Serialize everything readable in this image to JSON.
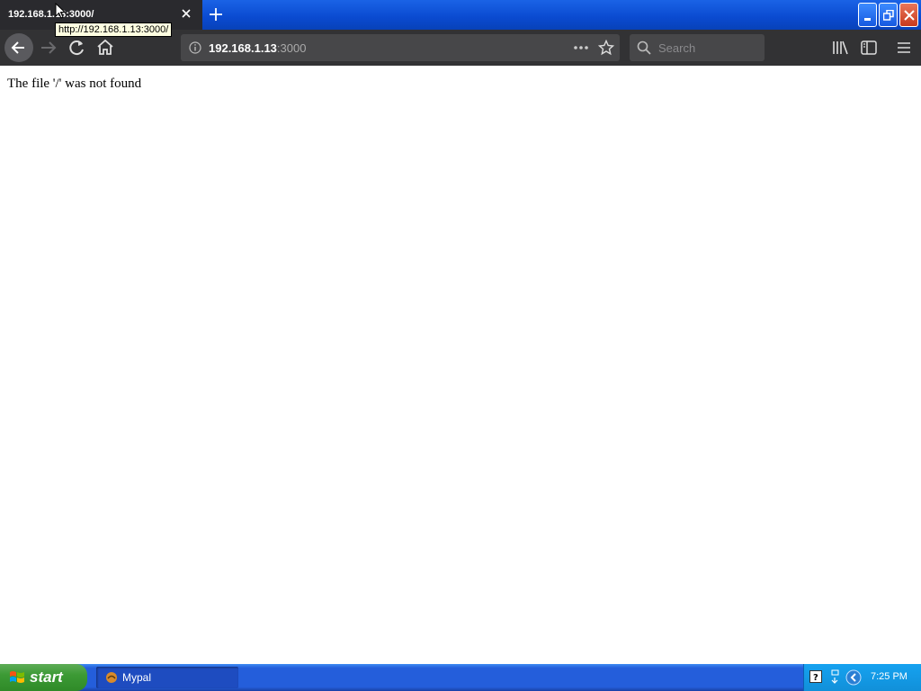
{
  "browser": {
    "tab_title": "192.168.1.13:3000/",
    "tooltip": "http://192.168.1.13:3000/",
    "url_host": "192.168.1.13",
    "url_port": ":3000",
    "search_placeholder": "Search"
  },
  "page": {
    "message": "The file '/' was not found"
  },
  "taskbar": {
    "start_label": "start",
    "task_label": "Mypal",
    "clock": "7:25 PM"
  },
  "colors": {
    "xp_blue": "#245edb",
    "start_green": "#3c9a35",
    "toolbar_dark": "#323234"
  }
}
